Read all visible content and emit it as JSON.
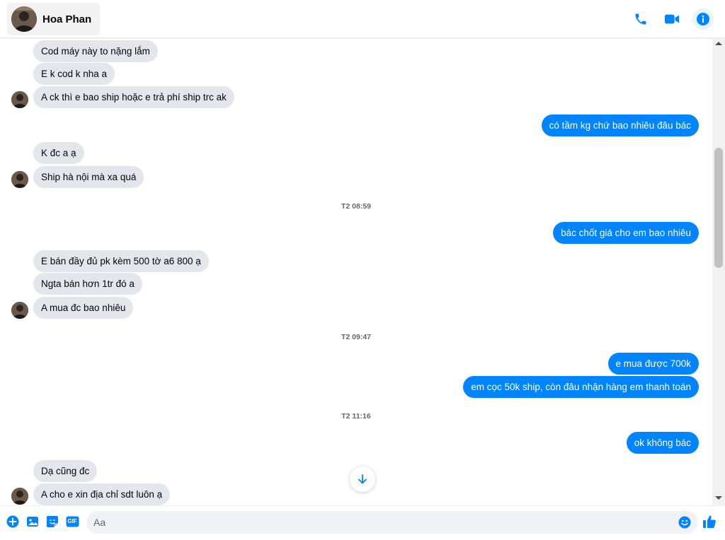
{
  "header": {
    "contact_name": "Hoa Phan",
    "icons": [
      "phone-icon",
      "video-icon",
      "info-icon"
    ]
  },
  "messages": [
    {
      "side": "in",
      "text": "Cod máy này to nặng lắm"
    },
    {
      "side": "in",
      "text": "E k cod k nha a"
    },
    {
      "side": "in",
      "text": "A ck thì e bao ship hoặc e trả phí ship trc ak",
      "avatar": true
    },
    {
      "side": "out",
      "text": "có tầm kg chứ bao nhiêu đâu bác"
    },
    {
      "side": "in",
      "text": "K đc a ạ"
    },
    {
      "side": "in",
      "text": "Ship hà nội mà xa quá",
      "avatar": true
    },
    {
      "timestamp": "T2 08:59"
    },
    {
      "side": "out",
      "text": "bác chốt giá cho em bao nhiêu"
    },
    {
      "side": "in",
      "text": "E bán đầy đủ pk kèm 500 tờ a6 800 ạ"
    },
    {
      "side": "in",
      "text": "Ngta bán hơn 1tr đó a"
    },
    {
      "side": "in",
      "text": "A mua đc bao nhiêu",
      "avatar": true
    },
    {
      "timestamp": "T2 09:47"
    },
    {
      "side": "out",
      "text": "e mua được 700k"
    },
    {
      "side": "out",
      "text": "em cọc 50k ship, còn đâu nhận hàng em thanh toán"
    },
    {
      "timestamp": "T2 11:16"
    },
    {
      "side": "out",
      "text": "ok không bác"
    },
    {
      "side": "in",
      "text": "Dạ cũng đc"
    },
    {
      "side": "in",
      "text": "A cho e xin địa chỉ sdt luôn ạ",
      "avatar": true
    }
  ],
  "composer": {
    "placeholder": "Aa",
    "gif_label": "GIF",
    "icons": [
      "plus-icon",
      "image-icon",
      "sticker-icon",
      "gif-icon",
      "emoji-icon",
      "like-icon"
    ]
  },
  "colors": {
    "accent": "#0084ff",
    "incoming_bubble": "#e4e6eb",
    "timestamp": "#65676b"
  }
}
